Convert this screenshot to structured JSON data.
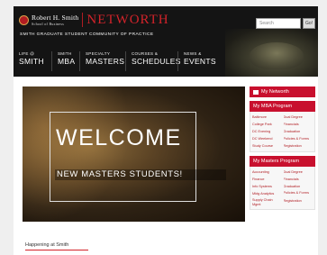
{
  "brand": {
    "school": "Robert H. Smith",
    "school_sub": "School of Business",
    "site": "NETWORTH",
    "tagline": "SMITH GRADUATE STUDENT COMMUNITY OF PRACTICE"
  },
  "search": {
    "placeholder": "Search",
    "button": "Go!"
  },
  "nav": [
    {
      "small": "LIFE @",
      "big": "SMITH"
    },
    {
      "small": "SMITH",
      "big": "MBA"
    },
    {
      "small": "SPECIALTY",
      "big": "MASTERS"
    },
    {
      "small": "COURSES &",
      "big": "SCHEDULES"
    },
    {
      "small": "NEWS &",
      "big": "EVENTS"
    }
  ],
  "hero": {
    "title": "WELCOME",
    "subtitle": "NEW MASTERS STUDENTS!"
  },
  "happening": "Happening at Smith",
  "sidebar": {
    "my_networth": "My Networth",
    "mba": {
      "title": "My MBA Program",
      "links": [
        "Baltimore",
        "Dual Degree",
        "College Park",
        "Financials",
        "DC Evening",
        "Graduation",
        "DC Weekend",
        "Policies & Forms",
        "Study Course",
        "Registration"
      ]
    },
    "masters": {
      "title": "My Masters Program",
      "links": [
        "Accounting",
        "Dual Degree",
        "Finance",
        "Financials",
        "Info Systems",
        "Graduation",
        "Mktg Analytics",
        "Policies & Forms",
        "Supply Chain Mgmt",
        "Registration"
      ]
    }
  }
}
